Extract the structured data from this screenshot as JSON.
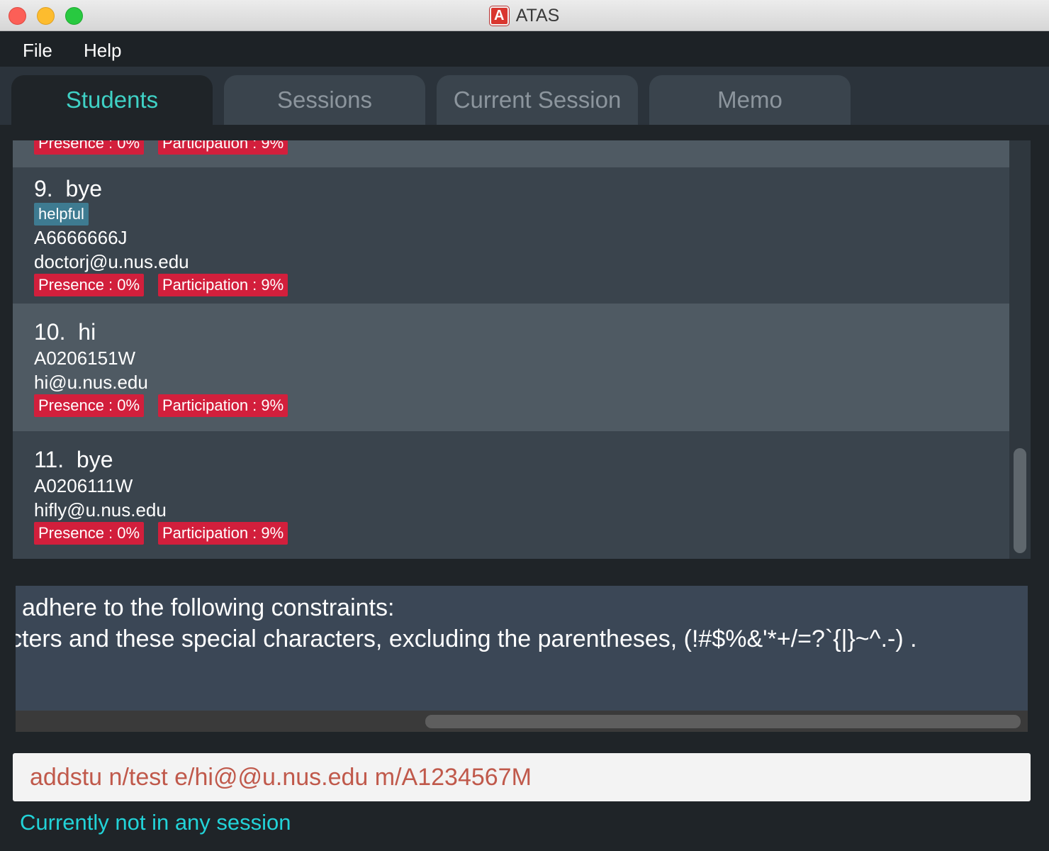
{
  "window": {
    "title": "ATAS",
    "app_icon_letter": "A"
  },
  "menu": {
    "items": [
      "File",
      "Help"
    ]
  },
  "tabs": [
    {
      "label": "Students",
      "active": true
    },
    {
      "label": "Sessions",
      "active": false
    },
    {
      "label": "Current Session",
      "active": false
    },
    {
      "label": "Memo",
      "active": false
    }
  ],
  "students": {
    "partial_top": {
      "presence": "Presence : 0%",
      "participation": "Participation : 9%"
    },
    "items": [
      {
        "index": "9.",
        "name": "bye",
        "tag": "helpful",
        "matric": "A6666666J",
        "email": "doctorj@u.nus.edu",
        "presence": "Presence : 0%",
        "participation": "Participation : 9%"
      },
      {
        "index": "10.",
        "name": "hi",
        "matric": "A0206151W",
        "email": "hi@u.nus.edu",
        "presence": "Presence : 0%",
        "participation": "Participation : 9%"
      },
      {
        "index": "11.",
        "name": "bye",
        "matric": "A0206111W",
        "email": "hifly@u.nus.edu",
        "presence": "Presence : 0%",
        "participation": "Participation : 9%"
      }
    ]
  },
  "result": {
    "line1": "adhere to the following constraints:",
    "line2": "cters and these special characters, excluding the parentheses, (!#$%&'*+/=?`{|}~^.-) ."
  },
  "command": {
    "value": "addstu n/test e/hi@@u.nus.edu m/A1234567M"
  },
  "status": {
    "text": "Currently not in any session"
  },
  "colors": {
    "accent": "#3fd1c5",
    "tag_red": "#d21f3c",
    "tag_blue": "#3e7b91",
    "status_text": "#22d3d8",
    "command_text": "#c0594b"
  }
}
